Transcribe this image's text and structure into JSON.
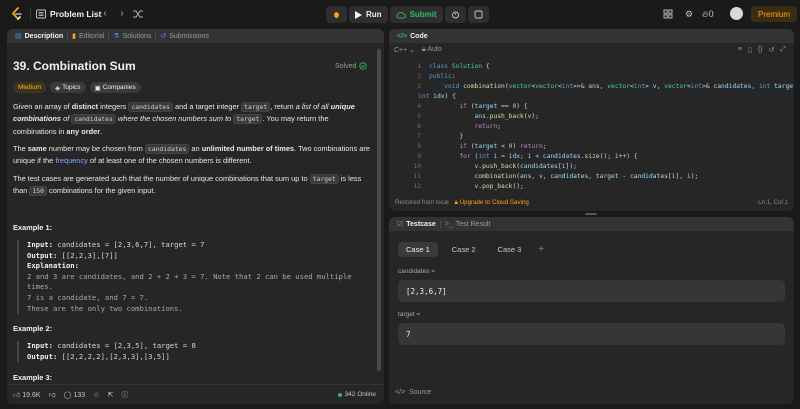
{
  "topbar": {
    "problem_list": "Problem List",
    "run": "Run",
    "submit": "Submit",
    "streak": "0",
    "premium": "Premium"
  },
  "left_tabs": [
    "Description",
    "Editorial",
    "Solutions",
    "Submissions"
  ],
  "problem": {
    "title": "39. Combination Sum",
    "status": "Solved",
    "difficulty": "Medium",
    "chips": [
      "Topics",
      "Companies"
    ],
    "p1": {
      "a": "Given an array of ",
      "b": "distinct",
      "c": " integers ",
      "d": "candidates",
      "e": " and a target integer ",
      "f": "target",
      "g": ", return ",
      "h": "a list of all ",
      "i": "unique combinations",
      "j": " of ",
      "k": "candidates",
      "l": " where the chosen numbers sum to ",
      "m": "target",
      "n": ". You may return the combinations in ",
      "o": "any order",
      "p": "."
    },
    "p2": {
      "a": "The ",
      "b": "same",
      "c": " number may be chosen from ",
      "d": "candidates",
      "e": " an ",
      "f": "unlimited number of times",
      "g": ". Two combinations are unique if the ",
      "h": "frequency",
      "i": " of at least one of the chosen numbers is different."
    },
    "p3": {
      "a": "The test cases are generated such that the number of unique combinations that sum up to ",
      "b": "target",
      "c": " is less than ",
      "d": "150",
      "e": " combinations for the given input."
    },
    "examples": [
      {
        "heading": "Example 1:",
        "input_label": "Input:",
        "input": " candidates = [2,3,6,7], target = 7",
        "output_label": "Output:",
        "output": " [[2,2,3],[7]]",
        "explanation_label": "Explanation:",
        "explanation": [
          "2 and 3 are candidates, and 2 + 2 + 3 = 7. Note that 2 can be used multiple",
          "times.",
          "7 is a candidate, and 7 = 7.",
          "These are the only two combinations."
        ]
      },
      {
        "heading": "Example 2:",
        "input_label": "Input:",
        "input": " candidates = [2,3,5], target = 8",
        "output_label": "Output:",
        "output": " [[2,2,2,2],[2,3,3],[3,5]]"
      },
      {
        "heading": "Example 3:"
      }
    ]
  },
  "bottom_bar": {
    "likes": "19.6K",
    "comments": "133",
    "online": "342 Online"
  },
  "code_panel": {
    "title": "Code",
    "language": "C++",
    "mode": "Auto",
    "line_numbers": [
      "1",
      "2",
      "3",
      "",
      "4",
      "5",
      "6",
      "7",
      "8",
      "9",
      "10",
      "11",
      "12"
    ],
    "restored": "Restored from local",
    "upgrade": "Upgrade to Cloud Saving",
    "position": "Ln 1, Col 1"
  },
  "test_panel": {
    "tabs": [
      "Testcase",
      "Test Result"
    ],
    "cases": [
      "Case 1",
      "Case 2",
      "Case 3"
    ],
    "plus": "+",
    "fields": [
      {
        "label": "candidates =",
        "value": "[2,3,6,7]"
      },
      {
        "label": "target =",
        "value": "7"
      }
    ],
    "source": "Source"
  },
  "colors": {
    "accent": "#ffa116",
    "green": "#2cbb5d",
    "medium": "#ffb800",
    "link": "#7fa8ff"
  }
}
